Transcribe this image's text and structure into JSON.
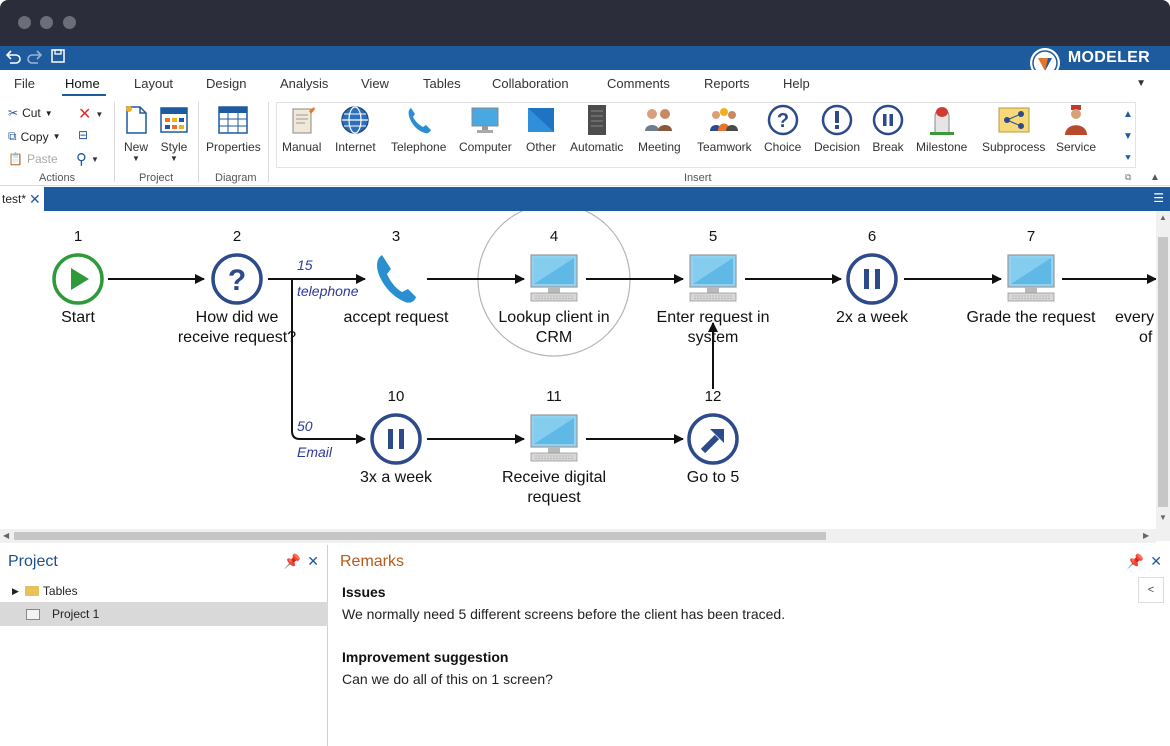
{
  "app": {
    "brand": "MODELER",
    "colors": {
      "primary": "#1e5a9e",
      "chrome": "#2b2d3a",
      "start": "#2e9a3a",
      "node": "#2d4a8a",
      "remarks_title": "#b75a1a"
    }
  },
  "quick_access": {
    "undo_icon": "undo-icon",
    "redo_icon": "redo-icon",
    "save_icon": "save-icon"
  },
  "menu": {
    "items": [
      "File",
      "Home",
      "Layout",
      "Design",
      "Analysis",
      "View",
      "Tables",
      "Collaboration",
      "Comments",
      "Reports",
      "Help"
    ],
    "active": "Home"
  },
  "ribbon": {
    "actions": {
      "cut": "Cut",
      "copy": "Copy",
      "paste": "Paste",
      "label": "Actions"
    },
    "project": {
      "new": "New",
      "style": "Style",
      "label": "Project"
    },
    "diagram": {
      "properties": "Properties",
      "label": "Diagram"
    },
    "insert": {
      "label": "Insert",
      "items": [
        "Manual",
        "Internet",
        "Telephone",
        "Computer",
        "Other",
        "Automatic",
        "Meeting",
        "Teamwork",
        "Choice",
        "Decision",
        "Break",
        "Milestone",
        "Subprocess",
        "Service"
      ]
    }
  },
  "document": {
    "tab_label": "test*"
  },
  "diagram": {
    "nodes": [
      {
        "id": "1",
        "label": "Start",
        "type": "start"
      },
      {
        "id": "2",
        "label": "How did we receive request?",
        "type": "choice"
      },
      {
        "id": "3",
        "label": "accept request",
        "type": "telephone"
      },
      {
        "id": "4",
        "label": "Lookup client in CRM",
        "type": "computer"
      },
      {
        "id": "5",
        "label": "Enter request in system",
        "type": "computer"
      },
      {
        "id": "6",
        "label": "2x a week",
        "type": "break"
      },
      {
        "id": "7",
        "label": "Grade the request",
        "type": "computer"
      },
      {
        "id": "8",
        "label": "every of",
        "type": "partial"
      },
      {
        "id": "10",
        "label": "3x a week",
        "type": "break"
      },
      {
        "id": "11",
        "label": "Receive digital request",
        "type": "computer"
      },
      {
        "id": "12",
        "label": "Go to 5",
        "type": "goto"
      }
    ],
    "edge_labels": {
      "telephone_count": "15",
      "telephone_text": "telephone",
      "email_count": "50",
      "email_text": "Email"
    }
  },
  "project_pane": {
    "title": "Project",
    "tree": [
      {
        "label": "Tables"
      },
      {
        "label": "Project 1"
      }
    ]
  },
  "remarks": {
    "title": "Remarks",
    "issues_heading": "Issues",
    "issues_text": "We normally need 5 different screens before the client has been traced.",
    "improvement_heading": "Improvement suggestion",
    "improvement_text": "Can we do all of this on 1 screen?",
    "collapse": "<"
  }
}
